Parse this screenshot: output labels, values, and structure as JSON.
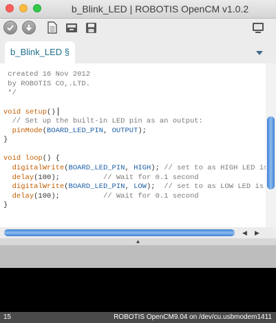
{
  "window": {
    "title": "b_Blink_LED | ROBOTIS OpenCM v1.0.2"
  },
  "toolbar": {
    "buttons": [
      {
        "name": "verify",
        "icon": "checkmark-icon"
      },
      {
        "name": "upload",
        "icon": "arrow-down-icon"
      },
      {
        "name": "new",
        "icon": "file-icon"
      },
      {
        "name": "open",
        "icon": "folder-icon"
      },
      {
        "name": "save",
        "icon": "save-icon"
      },
      {
        "name": "serial-monitor",
        "icon": "monitor-icon"
      }
    ]
  },
  "tabs": [
    {
      "label": "b_Blink_LED §",
      "active": true
    }
  ],
  "editor": {
    "lines": [
      [
        {
          "t": " created 16 Nov 2012",
          "c": "com"
        }
      ],
      [
        {
          "t": " by ROBOTIS CO,.LTD.",
          "c": "com"
        }
      ],
      [
        {
          "t": " */",
          "c": "com"
        }
      ],
      [
        {
          "t": "",
          "c": "punc"
        }
      ],
      [
        {
          "t": "void",
          "c": "kw"
        },
        {
          "t": " ",
          "c": "punc"
        },
        {
          "t": "setup",
          "c": "kw"
        },
        {
          "t": "()",
          "c": "punc"
        }
      ],
      [
        {
          "t": "  // Set up the built-in LED pin as an output:",
          "c": "com"
        }
      ],
      [
        {
          "t": "  ",
          "c": "punc"
        },
        {
          "t": "pinMode",
          "c": "kw"
        },
        {
          "t": "(",
          "c": "punc"
        },
        {
          "t": "BOARD_LED_PIN",
          "c": "const"
        },
        {
          "t": ", ",
          "c": "punc"
        },
        {
          "t": "OUTPUT",
          "c": "const"
        },
        {
          "t": ");",
          "c": "punc"
        }
      ],
      [
        {
          "t": "}",
          "c": "punc"
        }
      ],
      [
        {
          "t": "",
          "c": "punc"
        }
      ],
      [
        {
          "t": "void",
          "c": "kw"
        },
        {
          "t": " ",
          "c": "punc"
        },
        {
          "t": "loop",
          "c": "kw"
        },
        {
          "t": "() {",
          "c": "punc"
        }
      ],
      [
        {
          "t": "  ",
          "c": "punc"
        },
        {
          "t": "digitalWrite",
          "c": "kw"
        },
        {
          "t": "(",
          "c": "punc"
        },
        {
          "t": "BOARD_LED_PIN",
          "c": "const"
        },
        {
          "t": ", ",
          "c": "punc"
        },
        {
          "t": "HIGH",
          "c": "const"
        },
        {
          "t": "); ",
          "c": "punc"
        },
        {
          "t": "// set to as HIGH LED is tu",
          "c": "com"
        }
      ],
      [
        {
          "t": "  ",
          "c": "punc"
        },
        {
          "t": "delay",
          "c": "kw"
        },
        {
          "t": "(100);          ",
          "c": "punc"
        },
        {
          "t": "// Wait for 0.1 second",
          "c": "com"
        }
      ],
      [
        {
          "t": "  ",
          "c": "punc"
        },
        {
          "t": "digitalWrite",
          "c": "kw"
        },
        {
          "t": "(",
          "c": "punc"
        },
        {
          "t": "BOARD_LED_PIN",
          "c": "const"
        },
        {
          "t": ", ",
          "c": "punc"
        },
        {
          "t": "LOW",
          "c": "const"
        },
        {
          "t": ");  ",
          "c": "punc"
        },
        {
          "t": "// set to as LOW LED is tur",
          "c": "com"
        }
      ],
      [
        {
          "t": "  ",
          "c": "punc"
        },
        {
          "t": "delay",
          "c": "kw"
        },
        {
          "t": "(100);          ",
          "c": "punc"
        },
        {
          "t": "// Wait for 0.1 second",
          "c": "com"
        }
      ],
      [
        {
          "t": "}",
          "c": "punc"
        }
      ]
    ]
  },
  "status": {
    "line_number": "15",
    "board": "ROBOTIS OpenCM9.04 on /dev/cu.usbmodem1411"
  },
  "colors": {
    "keyword": "#c25e00",
    "constant": "#1d5fa6",
    "comment": "#7a7a7a",
    "tab_text": "#1f6f8b",
    "scroll_thumb": "#3d7fd6"
  }
}
